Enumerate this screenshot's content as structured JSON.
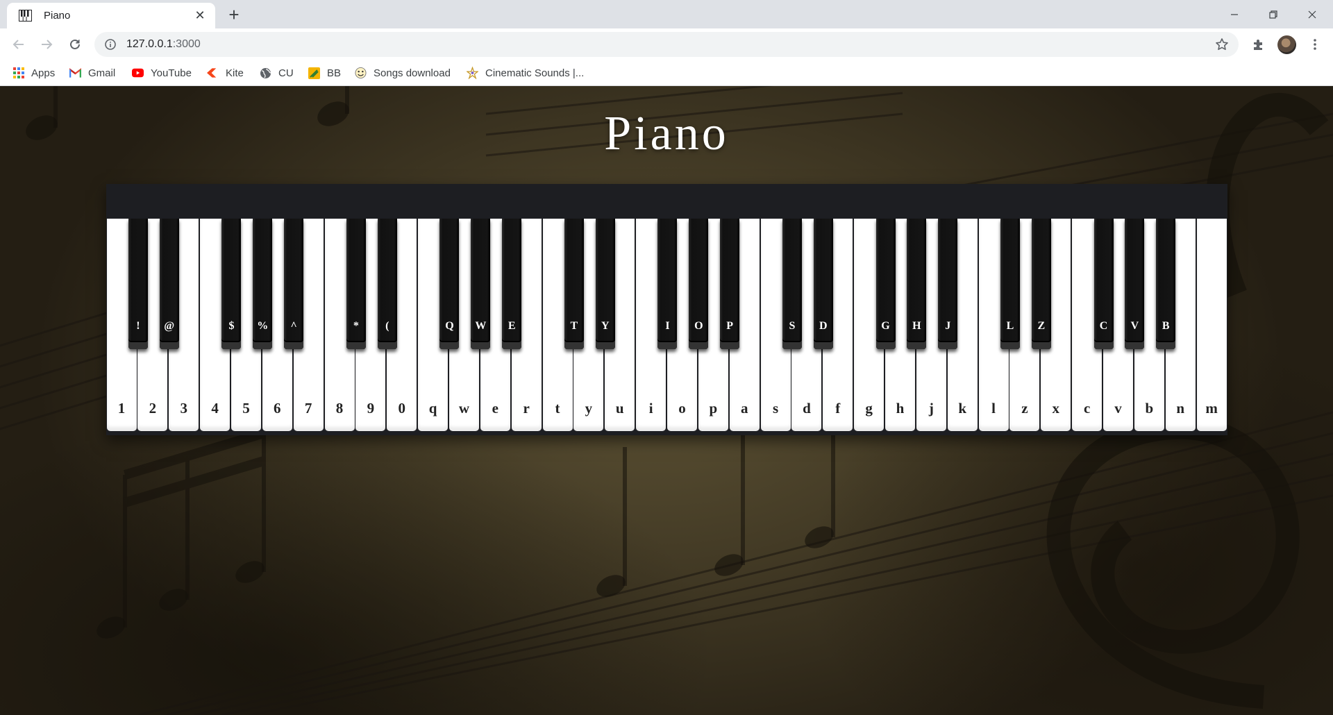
{
  "browser": {
    "tab": {
      "title": "Piano",
      "favicon": "piano-icon"
    },
    "address": {
      "host": "127.0.0.1",
      "port": ":3000"
    },
    "bookmarks": [
      {
        "label": "Apps",
        "icon": "apps-grid-icon"
      },
      {
        "label": "Gmail",
        "icon": "gmail-icon"
      },
      {
        "label": "YouTube",
        "icon": "youtube-icon"
      },
      {
        "label": "Kite",
        "icon": "kite-icon"
      },
      {
        "label": "CU",
        "icon": "globe-icon"
      },
      {
        "label": "BB",
        "icon": "bb-icon"
      },
      {
        "label": "Songs download",
        "icon": "songs-icon"
      },
      {
        "label": "Cinematic Sounds |...",
        "icon": "cinematic-icon"
      }
    ]
  },
  "page": {
    "title": "Piano",
    "white_keys": [
      "1",
      "2",
      "3",
      "4",
      "5",
      "6",
      "7",
      "8",
      "9",
      "0",
      "q",
      "w",
      "e",
      "r",
      "t",
      "y",
      "u",
      "i",
      "o",
      "p",
      "a",
      "s",
      "d",
      "f",
      "g",
      "h",
      "j",
      "k",
      "l",
      "z",
      "x",
      "c",
      "v",
      "b",
      "n",
      "m"
    ],
    "black_keys": [
      {
        "label": "!",
        "after_white": 0
      },
      {
        "label": "@",
        "after_white": 1
      },
      {
        "label": "$",
        "after_white": 3
      },
      {
        "label": "%",
        "after_white": 4
      },
      {
        "label": "^",
        "after_white": 5
      },
      {
        "label": "*",
        "after_white": 7
      },
      {
        "label": "(",
        "after_white": 8
      },
      {
        "label": "Q",
        "after_white": 10
      },
      {
        "label": "W",
        "after_white": 11
      },
      {
        "label": "E",
        "after_white": 12
      },
      {
        "label": "T",
        "after_white": 14
      },
      {
        "label": "Y",
        "after_white": 15
      },
      {
        "label": "I",
        "after_white": 17
      },
      {
        "label": "O",
        "after_white": 18
      },
      {
        "label": "P",
        "after_white": 19
      },
      {
        "label": "S",
        "after_white": 21
      },
      {
        "label": "D",
        "after_white": 22
      },
      {
        "label": "G",
        "after_white": 24
      },
      {
        "label": "H",
        "after_white": 25
      },
      {
        "label": "J",
        "after_white": 26
      },
      {
        "label": "L",
        "after_white": 28
      },
      {
        "label": "Z",
        "after_white": 29
      },
      {
        "label": "C",
        "after_white": 31
      },
      {
        "label": "V",
        "after_white": 32
      },
      {
        "label": "B",
        "after_white": 33
      }
    ]
  },
  "colors": {
    "piano_body": "#1d1e22",
    "white_key": "#ffffff",
    "black_key": "#111111",
    "title": "#ffffff"
  }
}
